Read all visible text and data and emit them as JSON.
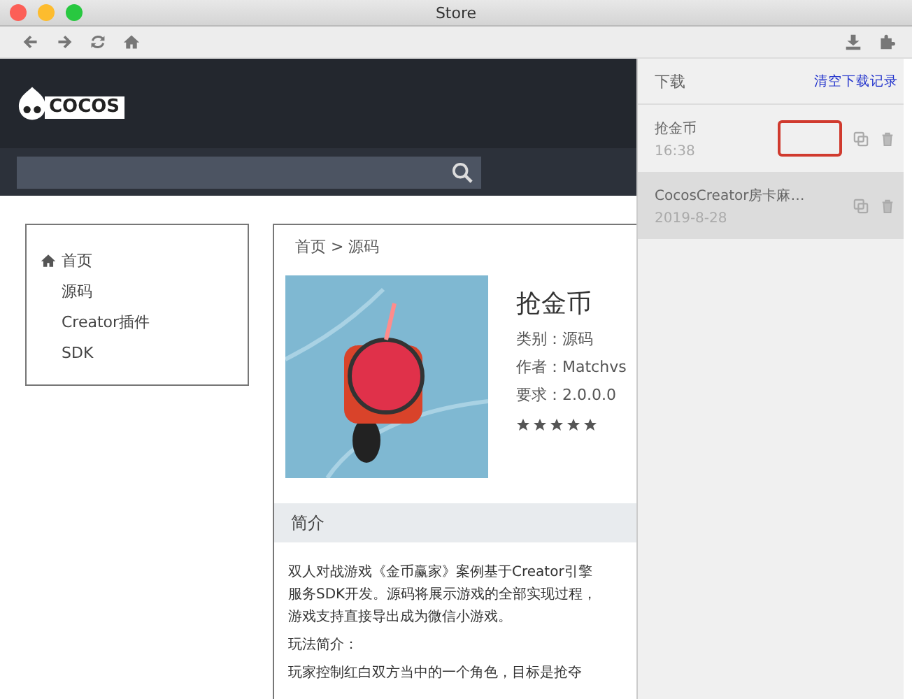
{
  "window": {
    "title": "Store"
  },
  "site": {
    "logo": "COCOS"
  },
  "nav": {
    "items": [
      {
        "label": "首页",
        "kind": "home"
      },
      {
        "label": "源码",
        "kind": "link"
      },
      {
        "label": "Creator插件",
        "kind": "link"
      },
      {
        "label": "SDK",
        "kind": "link"
      }
    ]
  },
  "breadcrumb": "首页 > 源码",
  "product": {
    "title": "抢金币",
    "meta": [
      "类别：源码",
      "作者：Matchvs",
      "要求：2.0.0.0"
    ],
    "stars": 5
  },
  "intro": {
    "heading": "简介",
    "lines": [
      "双人对战游戏《金币赢家》案例基于Creator引擎",
      "服务SDK开发。源码将展示游戏的全部实现过程，",
      "游戏支持直接导出成为微信小游戏。"
    ],
    "subheading": "玩法简介：",
    "lines2": [
      "玩家控制红白双方当中的一个角色，目标是抢夺"
    ]
  },
  "downloads": {
    "title": "下载",
    "clear_link": "清空下载记录",
    "items": [
      {
        "name": "抢金币",
        "time": "16:38",
        "selected": false,
        "highlighted": true
      },
      {
        "name": "CocosCreator房卡麻…",
        "time": "2019-8-28",
        "selected": true,
        "highlighted": false
      }
    ]
  }
}
